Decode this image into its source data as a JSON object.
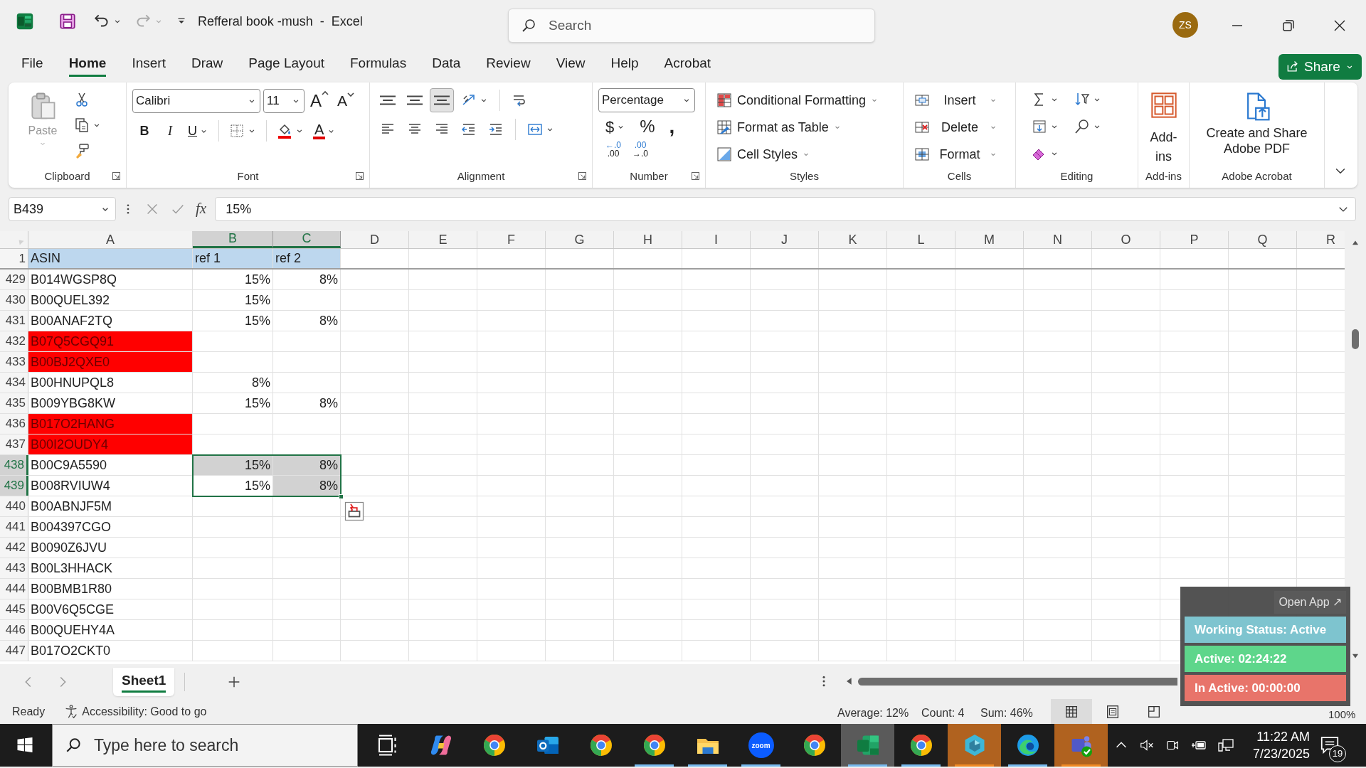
{
  "title_bar": {
    "title": "Refferal book -mush  -  Excel",
    "search_placeholder": "Search",
    "avatar": "ZS"
  },
  "menu_tabs": [
    {
      "label": "File",
      "selected": false
    },
    {
      "label": "Home",
      "selected": true
    },
    {
      "label": "Insert",
      "selected": false
    },
    {
      "label": "Draw",
      "selected": false
    },
    {
      "label": "Page Layout",
      "selected": false
    },
    {
      "label": "Formulas",
      "selected": false
    },
    {
      "label": "Data",
      "selected": false
    },
    {
      "label": "Review",
      "selected": false
    },
    {
      "label": "View",
      "selected": false
    },
    {
      "label": "Help",
      "selected": false
    },
    {
      "label": "Acrobat",
      "selected": false
    }
  ],
  "share_button": "Share",
  "ribbon": [
    {
      "kind": "clipboard",
      "label": "Clipboard",
      "launcher": true,
      "paste": "Paste"
    },
    {
      "kind": "font",
      "label": "Font",
      "launcher": true,
      "font_name": "Calibri",
      "font_size": "11",
      "grow": "A",
      "shrink": "A",
      "bold": "B",
      "italic": "I",
      "underline": "U",
      "font_color": "A"
    },
    {
      "kind": "alignment",
      "label": "Alignment",
      "launcher": true,
      "vertical_align": [
        {
          "selected": false
        },
        {
          "selected": false
        },
        {
          "selected": true
        }
      ]
    },
    {
      "kind": "number",
      "label": "Number",
      "launcher": true,
      "format": "Percentage",
      "currency": "$",
      "percent": "%",
      "comma": ",",
      "decimals": [
        {
          "top": "←.0",
          "bottom": ".00"
        },
        {
          "top": ".00",
          "bottom": "→.0"
        }
      ]
    },
    {
      "kind": "styles",
      "label": "Styles",
      "items": [
        "Conditional Formatting",
        "Format as Table",
        "Cell Styles"
      ]
    },
    {
      "kind": "cells",
      "label": "Cells",
      "items": [
        "Insert",
        "Delete",
        "Format"
      ]
    },
    {
      "kind": "editing",
      "label": "Editing"
    },
    {
      "kind": "addins",
      "label": "Add-ins",
      "button": "Add-ins"
    },
    {
      "kind": "acrobat",
      "label": "Adobe Acrobat",
      "button": "Create and Share Adobe PDF"
    }
  ],
  "formula_bar": {
    "name_box": "B439",
    "fx": "fx",
    "formula": "15%"
  },
  "sheet": {
    "columns": [
      {
        "label": "A",
        "selected": false
      },
      {
        "label": "B",
        "selected": true
      },
      {
        "label": "C",
        "selected": true
      },
      {
        "label": "D",
        "selected": false
      },
      {
        "label": "E",
        "selected": false
      },
      {
        "label": "F",
        "selected": false
      },
      {
        "label": "G",
        "selected": false
      },
      {
        "label": "H",
        "selected": false
      },
      {
        "label": "I",
        "selected": false
      },
      {
        "label": "J",
        "selected": false
      },
      {
        "label": "K",
        "selected": false
      },
      {
        "label": "L",
        "selected": false
      },
      {
        "label": "M",
        "selected": false
      },
      {
        "label": "N",
        "selected": false
      },
      {
        "label": "O",
        "selected": false
      },
      {
        "label": "P",
        "selected": false
      },
      {
        "label": "Q",
        "selected": false
      },
      {
        "label": "R",
        "selected": false
      }
    ],
    "header_row": {
      "number": "1",
      "selected": false,
      "cells": [
        {
          "text": "ASIN",
          "color": "#bdd7ee"
        },
        {
          "text": "ref 1",
          "color": "#bdd7ee"
        },
        {
          "text": "ref 2",
          "color": "#bdd7ee"
        }
      ]
    },
    "rows": [
      {
        "number": "429",
        "selected": false,
        "asin": {
          "text": "B014WGSP8Q",
          "selected": false
        },
        "ref_1": {
          "text": "15%",
          "selected": false
        },
        "ref_2": {
          "text": "8%",
          "selected": false
        }
      },
      {
        "number": "430",
        "selected": false,
        "asin": {
          "text": "B00QUEL392",
          "selected": false
        },
        "ref_1": {
          "text": "15%",
          "selected": false
        }
      },
      {
        "number": "431",
        "selected": false,
        "asin": {
          "text": "B00ANAF2TQ",
          "selected": false
        },
        "ref_1": {
          "text": "15%",
          "selected": false
        },
        "ref_2": {
          "text": "8%",
          "selected": false
        }
      },
      {
        "number": "432",
        "selected": false,
        "asin": {
          "text": "B07Q5CGQ91",
          "selected": false,
          "color": "#ff0000"
        }
      },
      {
        "number": "433",
        "selected": false,
        "asin": {
          "text": "B00BJ2QXE0",
          "selected": false,
          "color": "#ff0000"
        }
      },
      {
        "number": "434",
        "selected": false,
        "asin": {
          "text": "B00HNUPQL8",
          "selected": false
        },
        "ref_1": {
          "text": "8%",
          "selected": false
        }
      },
      {
        "number": "435",
        "selected": false,
        "asin": {
          "text": "B009YBG8KW",
          "selected": false
        },
        "ref_1": {
          "text": "15%",
          "selected": false
        },
        "ref_2": {
          "text": "8%",
          "selected": false
        }
      },
      {
        "number": "436",
        "selected": false,
        "asin": {
          "text": "B017O2HANG",
          "selected": false,
          "color": "#ff0000"
        }
      },
      {
        "number": "437",
        "selected": false,
        "asin": {
          "text": "B00I2OUDY4",
          "selected": false,
          "color": "#ff0000"
        }
      },
      {
        "number": "438",
        "selected": true,
        "asin": {
          "text": "B00C9A5590",
          "selected": false
        },
        "ref_1": {
          "text": "15%",
          "selected": true
        },
        "ref_2": {
          "text": "8%",
          "selected": true
        }
      },
      {
        "number": "439",
        "selected": true,
        "asin": {
          "text": "B008RVIUW4",
          "selected": false
        },
        "ref_1": {
          "text": "15%",
          "active": true
        },
        "ref_2": {
          "text": "8%",
          "selected": true
        }
      },
      {
        "number": "440",
        "selected": false,
        "asin": {
          "text": "B00ABNJF5M",
          "selected": false
        }
      },
      {
        "number": "441",
        "selected": false,
        "asin": {
          "text": "B004397CGO",
          "selected": false
        }
      },
      {
        "number": "442",
        "selected": false,
        "asin": {
          "text": "B0090Z6JVU",
          "selected": false
        }
      },
      {
        "number": "443",
        "selected": false,
        "asin": {
          "text": "B00L3HHACK",
          "selected": false
        }
      },
      {
        "number": "444",
        "selected": false,
        "asin": {
          "text": "B00BMB1R80",
          "selected": false
        }
      },
      {
        "number": "445",
        "selected": false,
        "asin": {
          "text": "B00V6Q5CGE",
          "selected": false
        }
      },
      {
        "number": "446",
        "selected": false,
        "asin": {
          "text": "B00QUEHY4A",
          "selected": false
        }
      },
      {
        "number": "447",
        "selected": false,
        "asin": {
          "text": "B017O2CKT0",
          "selected": false
        }
      }
    ]
  },
  "sheet_tabs": [
    {
      "label": "Sheet1",
      "selected": true
    }
  ],
  "status_bar": {
    "ready": "Ready",
    "accessibility": "Accessibility: Good to go",
    "average": "Average: 12%",
    "count": "Count: 4",
    "sum": "Sum: 46%",
    "zoom": "100%",
    "views": [
      {
        "kind": "normal",
        "selected": true
      },
      {
        "kind": "page-layout",
        "selected": false
      },
      {
        "kind": "page-break",
        "selected": false
      }
    ]
  },
  "tracker_widget": {
    "open_app": "Open App ↗",
    "rows": [
      {
        "text": "Working Status: Active",
        "color": "#7ec4cf"
      },
      {
        "text": "Active: 02:24:22",
        "color": "#5ed68b"
      },
      {
        "text": "In Active: 00:00:00",
        "color": "#e8746a"
      }
    ]
  },
  "taskbar": {
    "search_placeholder": "Type here to search",
    "apps": [
      {
        "kind": "task-view",
        "running": false,
        "active": false,
        "flashing": false
      },
      {
        "kind": "copilot",
        "running": false,
        "active": false,
        "flashing": false
      },
      {
        "kind": "chrome",
        "running": false,
        "active": false,
        "flashing": false
      },
      {
        "kind": "outlook",
        "running": false,
        "active": false,
        "flashing": false
      },
      {
        "kind": "chrome",
        "running": false,
        "active": false,
        "flashing": false
      },
      {
        "kind": "chrome",
        "running": true,
        "active": false,
        "flashing": false
      },
      {
        "kind": "file-explorer",
        "running": true,
        "active": false,
        "flashing": false
      },
      {
        "kind": "zoom",
        "label": "zoom",
        "running": true,
        "active": false,
        "flashing": false
      },
      {
        "kind": "chrome",
        "running": false,
        "active": false,
        "flashing": false
      },
      {
        "kind": "excel",
        "running": true,
        "active": true,
        "flashing": false
      },
      {
        "kind": "chrome",
        "running": true,
        "active": false,
        "flashing": false
      },
      {
        "kind": "app",
        "running": true,
        "active": false,
        "flashing": true
      },
      {
        "kind": "edge",
        "running": true,
        "active": false,
        "flashing": false
      },
      {
        "kind": "teams",
        "running": true,
        "active": false,
        "flashing": true
      }
    ],
    "time": "11:22 AM",
    "date": "7/23/2025",
    "notifications": "19"
  }
}
